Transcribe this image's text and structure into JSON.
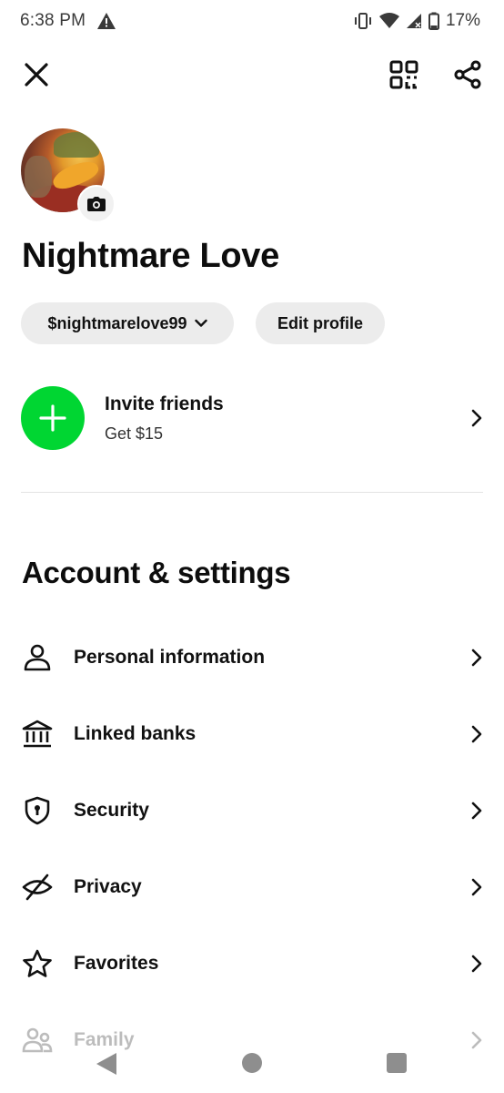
{
  "status_bar": {
    "time": "6:38 PM",
    "battery": "17%",
    "icons": [
      "warning-icon",
      "vibrate-icon",
      "wifi-icon",
      "signal-icon",
      "battery-icon"
    ]
  },
  "top_bar": {
    "icons": [
      "close-icon",
      "qr-code-icon",
      "share-icon"
    ]
  },
  "profile": {
    "name": "Nightmare Love",
    "cashtag": "$nightmarelove99",
    "edit_label": "Edit profile"
  },
  "invite": {
    "title": "Invite friends",
    "subtitle": "Get $15",
    "accent": "#00d632"
  },
  "section": {
    "title": "Account & settings"
  },
  "settings_items": [
    {
      "label": "Personal information",
      "icon": "person-icon"
    },
    {
      "label": "Linked banks",
      "icon": "bank-icon"
    },
    {
      "label": "Security",
      "icon": "shield-icon"
    },
    {
      "label": "Privacy",
      "icon": "eye-off-icon"
    },
    {
      "label": "Favorites",
      "icon": "star-icon"
    },
    {
      "label": "Family",
      "icon": "family-icon"
    }
  ],
  "nav_bar": {
    "icons": [
      "back-icon",
      "home-icon",
      "recents-icon"
    ]
  }
}
